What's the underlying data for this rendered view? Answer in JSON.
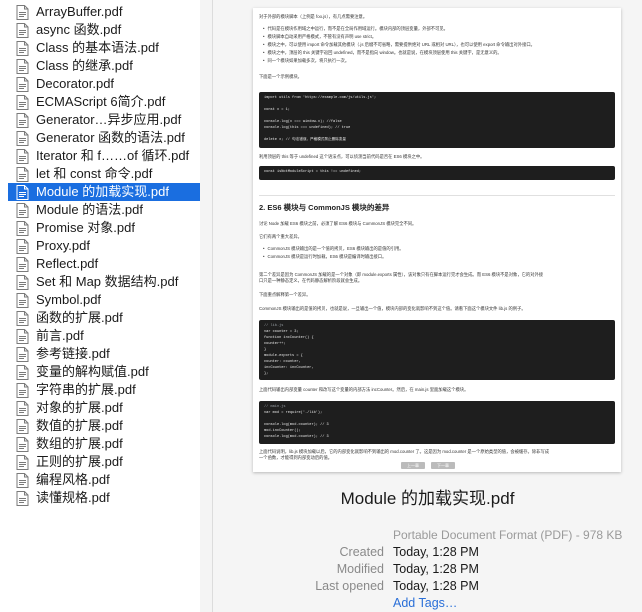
{
  "sidebar": {
    "files": [
      {
        "label": "ArrayBuffer.pdf"
      },
      {
        "label": "async 函数.pdf"
      },
      {
        "label": "Class 的基本语法.pdf"
      },
      {
        "label": "Class 的继承.pdf"
      },
      {
        "label": "Decorator.pdf"
      },
      {
        "label": "ECMAScript 6简介.pdf"
      },
      {
        "label": "Generator…异步应用.pdf"
      },
      {
        "label": "Generator 函数的语法.pdf"
      },
      {
        "label": "Iterator 和 f……of 循环.pdf"
      },
      {
        "label": "let 和 const 命令.pdf"
      },
      {
        "label": "Module 的加载实现.pdf",
        "selected": true
      },
      {
        "label": "Module 的语法.pdf"
      },
      {
        "label": "Promise 对象.pdf"
      },
      {
        "label": "Proxy.pdf"
      },
      {
        "label": "Reflect.pdf"
      },
      {
        "label": "Set 和 Map 数据结构.pdf"
      },
      {
        "label": "Symbol.pdf"
      },
      {
        "label": "函数的扩展.pdf"
      },
      {
        "label": "前言.pdf"
      },
      {
        "label": "参考链接.pdf"
      },
      {
        "label": "变量的解构赋值.pdf"
      },
      {
        "label": "字符串的扩展.pdf"
      },
      {
        "label": "对象的扩展.pdf"
      },
      {
        "label": "数值的扩展.pdf"
      },
      {
        "label": "数组的扩展.pdf"
      },
      {
        "label": "正则的扩展.pdf"
      },
      {
        "label": "编程风格.pdf"
      },
      {
        "label": "读懂规格.pdf"
      }
    ]
  },
  "preview": {
    "doc": {
      "intro": "对于外部的模块脚本（上例是 foo.js），有几点需要注意。",
      "bullets": [
        "代码是在模块作用域之中运行，而不是在全局作用域运行。模块内部的顶层变量，外部不可见。",
        "模块脚本自动采用严格模式，不管有没有声明 use strict。",
        "模块之中，可以使用 import 命令加载其他模块（.js 后缀不可省略，需要提供绝对 URL 或相对 URL），也可以使用 export 命令输出对外接口。",
        "模块之中，顶层的 this 关键字返回 undefined，而不是指向 window。也就是说，在模块顶层使用 this 关键字，是无意义的。",
        "同一个模块如果加载多次，将只执行一次。"
      ],
      "example_intro": "下面是一个示例模块。",
      "code1": [
        "import utils from 'https://example.com/js/utils.js';",
        "",
        "const x = 1;",
        "",
        "console.log(x === window.x); //false",
        "console.log(this === undefined); // true",
        "",
        "delete x; // 句法错误，严格模式禁止删除变量"
      ],
      "this_note": "利用顶层的 this 等于 undefined 这个语法点，可以侦测当前代码是否在 ES6 模块之中。",
      "code2": [
        "const isNotModuleScript = this !== undefined;"
      ],
      "section_title": "2. ES6 模块与 CommonJS 模块的差异",
      "section_intro": "讨论 Node 加载 ES6 模块之前，必须了解 ES6 模块与 CommonJS 模块完全不同。",
      "diff_intro": "它们有两个重大差异。",
      "diffs": [
        "CommonJS 模块输出的是一个值的拷贝，ES6 模块输出的是值的引用。",
        "CommonJS 模块是运行时加载，ES6 模块是编译时输出接口。"
      ],
      "para2": "第二个差异是因为 CommonJS 加载的是一个对象（即 module.exports 属性），该对象只有在脚本运行完才会生成。而 ES6 模块不是对象，它的对外接",
      "para2b": "口只是一种静态定义，在代码静态解析阶段就会生成。",
      "para3": "下面重点解释第一个差异。",
      "para4": "CommonJS 模块输出的是值的拷贝，也就是说，一旦输出一个值，模块内部的变化就影响不到这个值。请看下面这个模块文件 lib.js 的例子。",
      "code3": [
        "// lib.js",
        "var counter = 3;",
        "function incCounter() {",
        "  counter++;",
        "}",
        "module.exports = {",
        "  counter: counter,",
        "  incCounter: incCounter,",
        "};"
      ],
      "para5": "上面代码输出内部变量 counter 和改写这个变量的内部方法 incCounter。然后，在 main.js 里面加载这个模块。",
      "code4": [
        "// main.js",
        "var mod = require('./lib');",
        "",
        "console.log(mod.counter);  // 3",
        "mod.incCounter();",
        "console.log(mod.counter); // 3"
      ],
      "para6": "上面代码说明，lib.js 模块加载以后，它的内部变化就影响不到输出的 mod.counter 了。这是因为 mod.counter 是一个原始类型的值，会被缓存。除非写成",
      "para6b": "一个函数，才能得到内部变动后的值。",
      "pager_prev": "上一章",
      "pager_next": "下一章"
    },
    "title": "Module 的加载实现.pdf",
    "kind": "Portable Document Format (PDF) - 978 KB",
    "meta": [
      {
        "key": "Created",
        "value": "Today, 1:28 PM"
      },
      {
        "key": "Modified",
        "value": "Today, 1:28 PM"
      },
      {
        "key": "Last opened",
        "value": "Today, 1:28 PM"
      }
    ],
    "add_tags": "Add Tags…"
  }
}
